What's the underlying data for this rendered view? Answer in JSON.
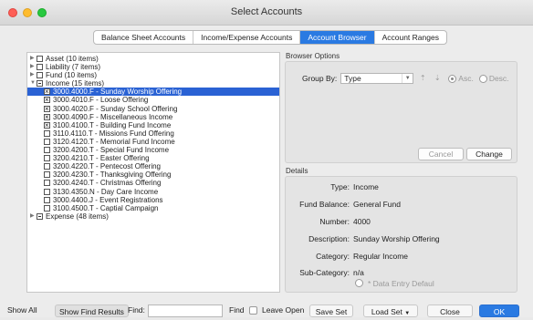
{
  "window": {
    "title": "Select Accounts"
  },
  "tabs": [
    {
      "label": "Balance Sheet Accounts",
      "active": false
    },
    {
      "label": "Income/Expense Accounts",
      "active": false
    },
    {
      "label": "Account Browser",
      "active": true
    },
    {
      "label": "Account Ranges",
      "active": false
    }
  ],
  "tree": [
    {
      "label": "Asset (10 items)",
      "level": 0,
      "expanded": false,
      "check": "empty",
      "selected": false
    },
    {
      "label": "Liability (7 items)",
      "level": 0,
      "expanded": false,
      "check": "empty",
      "selected": false
    },
    {
      "label": "Fund (10 items)",
      "level": 0,
      "expanded": false,
      "check": "empty",
      "selected": false
    },
    {
      "label": "Income (15 items)",
      "level": 0,
      "expanded": true,
      "check": "minus",
      "selected": false
    },
    {
      "label": "3000.4000.F - Sunday Worship Offering",
      "level": 1,
      "check": "x",
      "selected": true
    },
    {
      "label": "3000.4010.F - Loose Offering",
      "level": 1,
      "check": "x",
      "selected": false
    },
    {
      "label": "3000.4020.F - Sunday School Offering",
      "level": 1,
      "check": "x",
      "selected": false
    },
    {
      "label": "3000.4090.F - Miscellaneous Income",
      "level": 1,
      "check": "x",
      "selected": false
    },
    {
      "label": "3100.4100.T - Building Fund Income",
      "level": 1,
      "check": "x",
      "selected": false
    },
    {
      "label": "3110.4110.T - Missions Fund Offering",
      "level": 1,
      "check": "empty",
      "selected": false
    },
    {
      "label": "3120.4120.T - Memorial Fund Income",
      "level": 1,
      "check": "empty",
      "selected": false
    },
    {
      "label": "3200.4200.T - Special Fund Income",
      "level": 1,
      "check": "empty",
      "selected": false
    },
    {
      "label": "3200.4210.T - Easter Offering",
      "level": 1,
      "check": "empty",
      "selected": false
    },
    {
      "label": "3200.4220.T - Pentecost Offering",
      "level": 1,
      "check": "empty",
      "selected": false
    },
    {
      "label": "3200.4230.T - Thanksgiving Offering",
      "level": 1,
      "check": "empty",
      "selected": false
    },
    {
      "label": "3200.4240.T - Christmas Offering",
      "level": 1,
      "check": "empty",
      "selected": false
    },
    {
      "label": "3130.4350.N - Day Care Income",
      "level": 1,
      "check": "empty",
      "selected": false
    },
    {
      "label": "3000.4400.J - Event Registrations",
      "level": 1,
      "check": "empty",
      "selected": false
    },
    {
      "label": "3100.4500.T - Captial Campaign",
      "level": 1,
      "check": "empty",
      "selected": false
    },
    {
      "label": "Expense (48 items)",
      "level": 0,
      "expanded": false,
      "check": "minus",
      "selected": false
    }
  ],
  "browser_options": {
    "section_label": "Browser Options",
    "group_by_label": "Group By:",
    "group_by_value": "Type",
    "asc_label": "Asc.",
    "desc_label": "Desc.",
    "cancel_label": "Cancel",
    "change_label": "Change"
  },
  "details": {
    "section_label": "Details",
    "rows": [
      {
        "key": "Type:",
        "value": "Income"
      },
      {
        "key": "Fund Balance:",
        "value": "General Fund"
      },
      {
        "key": "Number:",
        "value": "4000"
      },
      {
        "key": "Description:",
        "value": "Sunday Worship Offering"
      },
      {
        "key": "Category:",
        "value": "Regular Income"
      },
      {
        "key": "Sub-Category:",
        "value": "n/a"
      }
    ],
    "data_entry_label": "* Data Entry Defaul"
  },
  "bottom": {
    "show_all": "Show All",
    "show_find_results": "Show Find Results",
    "find_label": "Find:",
    "find_value": "",
    "find_button": "Find",
    "leave_open": "Leave Open",
    "save_set": "Save Set",
    "load_set": "Load Set",
    "close": "Close",
    "ok": "OK"
  }
}
